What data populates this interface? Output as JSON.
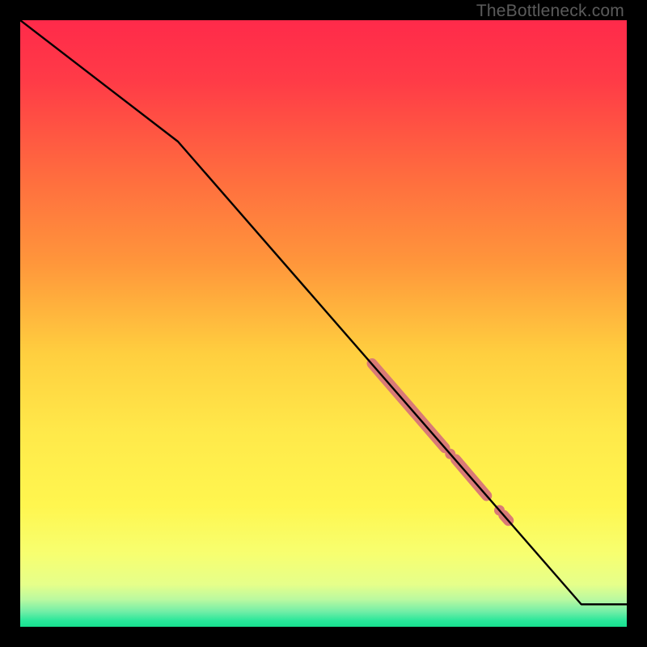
{
  "watermark": "TheBottleneck.com",
  "gradient": {
    "stops": [
      {
        "offset": 0.0,
        "color": "#ff2a4a"
      },
      {
        "offset": 0.1,
        "color": "#ff3b47"
      },
      {
        "offset": 0.25,
        "color": "#ff6a3f"
      },
      {
        "offset": 0.4,
        "color": "#ff963b"
      },
      {
        "offset": 0.55,
        "color": "#ffcf3f"
      },
      {
        "offset": 0.68,
        "color": "#ffe94a"
      },
      {
        "offset": 0.8,
        "color": "#fff64f"
      },
      {
        "offset": 0.88,
        "color": "#f7ff70"
      },
      {
        "offset": 0.93,
        "color": "#e6ff8a"
      },
      {
        "offset": 0.955,
        "color": "#baf9a0"
      },
      {
        "offset": 0.975,
        "color": "#72eea7"
      },
      {
        "offset": 0.99,
        "color": "#29e79a"
      },
      {
        "offset": 1.0,
        "color": "#17e08e"
      }
    ]
  },
  "chart_data": {
    "type": "line",
    "title": "",
    "xlabel": "",
    "ylabel": "",
    "xlim": [
      0,
      100
    ],
    "ylim": [
      0,
      100
    ],
    "series": [
      {
        "name": "curve",
        "points": [
          {
            "x": 0.0,
            "y": 100.0
          },
          {
            "x": 26.0,
            "y": 80.0
          },
          {
            "x": 92.5,
            "y": 3.7
          },
          {
            "x": 100.0,
            "y": 3.7
          }
        ]
      }
    ],
    "highlights": [
      {
        "x0": 58.0,
        "y0": 43.4,
        "x1": 70.0,
        "y1": 29.5
      },
      {
        "x0": 71.8,
        "y0": 27.6,
        "x1": 76.9,
        "y1": 21.6
      },
      {
        "x0": 79.7,
        "y0": 18.4,
        "x1": 80.5,
        "y1": 17.5
      }
    ],
    "highlight_dots": [
      {
        "x": 70.9,
        "y": 28.5
      },
      {
        "x": 79.0,
        "y": 19.2
      }
    ]
  },
  "curve_style": {
    "stroke": "#000000",
    "stroke_width": 2.4
  },
  "highlight_style": {
    "color": "#d97a76",
    "cap_width": 13,
    "dot_radius": 6.5
  }
}
